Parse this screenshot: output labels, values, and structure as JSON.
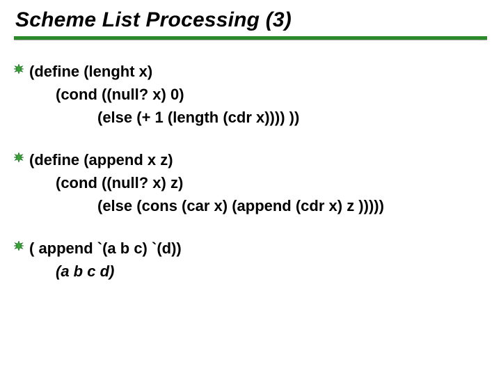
{
  "title": "Scheme List Processing (3)",
  "bullets": [
    {
      "line1": "(define (lenght x)",
      "line2": "(cond ((null? x) 0)",
      "line3": "(else (+ 1 (length (cdr x)))) ))"
    },
    {
      "line1": "(define (append x z)",
      "line2": "(cond ((null? x) z)",
      "line3": "(else (cons (car x) (append (cdr x) z )))))"
    },
    {
      "line1": "( append  `(a b c) `(d))",
      "line2": "(a b c d)"
    }
  ],
  "colors": {
    "rule": "#2a8a2a",
    "bullet_outer": "#1d6e1d",
    "bullet_inner": "#3aa33a"
  }
}
